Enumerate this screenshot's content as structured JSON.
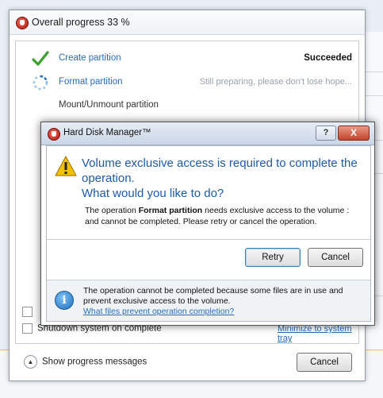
{
  "progress_window": {
    "title": "Overall progress 33 %",
    "steps": [
      {
        "label": "Create partition",
        "status": "Succeeded",
        "icon": "check-icon"
      },
      {
        "label": "Format partition",
        "status": "Still preparing, please don't lose hope...",
        "icon": "spinner-icon"
      },
      {
        "label": "Mount/Unmount partition",
        "status": "",
        "icon": ""
      }
    ],
    "option_hidden_label": "",
    "shutdown_label": "Shutdown system on complete",
    "minimize_link": "Minimize to system tray",
    "show_messages_label": "Show progress messages",
    "cancel_label": "Cancel"
  },
  "dialog": {
    "title": "Hard Disk Manager™",
    "help_label": "?",
    "close_label": "X",
    "main_instruction_line1": "Volume exclusive access is required to complete the operation.",
    "main_instruction_line2": "What would you like to do?",
    "content_prefix": "The operation ",
    "content_bold": "Format partition",
    "content_suffix": " needs exclusive access to the volume : and cannot be completed. Please retry or cancel the operation.",
    "retry_label": "Retry",
    "cancel_label": "Cancel",
    "footer_text": "The operation cannot be completed because some files are in use and prevent exclusive access to the volume.",
    "footer_link": "What files prevent operation completion?"
  },
  "colors": {
    "instruction_blue": "#1e5aa8",
    "link_blue": "#2a6bb8",
    "warning_yellow": "#f2c200"
  }
}
